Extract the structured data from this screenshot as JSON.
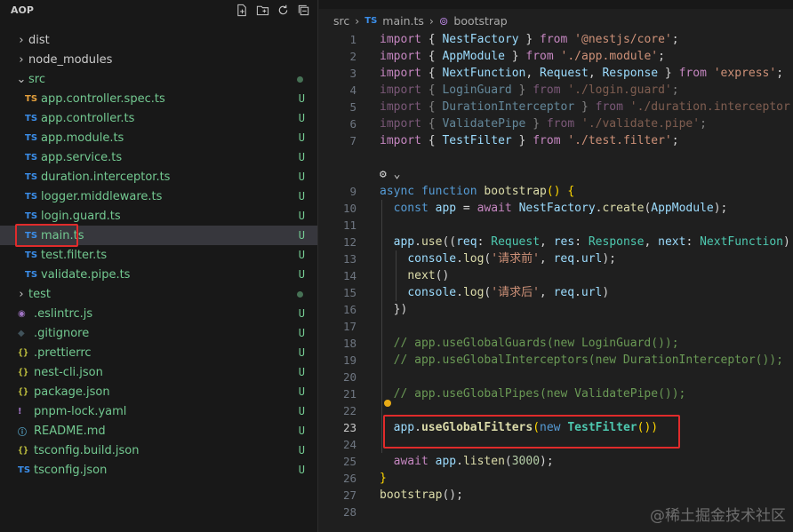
{
  "explorer": {
    "title": "AOP",
    "actions": [
      "new-file-icon",
      "new-folder-icon",
      "refresh-icon",
      "collapse-all-icon"
    ],
    "items": [
      {
        "name": "dist",
        "type": "folder",
        "open": false,
        "depth": 0,
        "status": ""
      },
      {
        "name": "node_modules",
        "type": "folder",
        "open": false,
        "depth": 0,
        "status": ""
      },
      {
        "name": "src",
        "type": "folder",
        "open": true,
        "depth": 0,
        "status": "dot"
      },
      {
        "name": "app.controller.spec.ts",
        "type": "ts-test",
        "depth": 1,
        "status": "U"
      },
      {
        "name": "app.controller.ts",
        "type": "ts",
        "depth": 1,
        "status": "U"
      },
      {
        "name": "app.module.ts",
        "type": "ts",
        "depth": 1,
        "status": "U"
      },
      {
        "name": "app.service.ts",
        "type": "ts",
        "depth": 1,
        "status": "U"
      },
      {
        "name": "duration.interceptor.ts",
        "type": "ts",
        "depth": 1,
        "status": "U"
      },
      {
        "name": "logger.middleware.ts",
        "type": "ts",
        "depth": 1,
        "status": "U"
      },
      {
        "name": "login.guard.ts",
        "type": "ts",
        "depth": 1,
        "status": "U"
      },
      {
        "name": "main.ts",
        "type": "ts",
        "depth": 1,
        "status": "U",
        "selected": true
      },
      {
        "name": "test.filter.ts",
        "type": "ts",
        "depth": 1,
        "status": "U"
      },
      {
        "name": "validate.pipe.ts",
        "type": "ts",
        "depth": 1,
        "status": "U"
      },
      {
        "name": "test",
        "type": "folder",
        "open": false,
        "depth": 0,
        "status": "dot"
      },
      {
        "name": ".eslintrc.js",
        "type": "js",
        "depth": 0,
        "status": "U"
      },
      {
        "name": ".gitignore",
        "type": "git",
        "depth": 0,
        "status": "U"
      },
      {
        "name": ".prettierrc",
        "type": "json",
        "depth": 0,
        "status": "U"
      },
      {
        "name": "nest-cli.json",
        "type": "json",
        "depth": 0,
        "status": "U"
      },
      {
        "name": "package.json",
        "type": "json",
        "depth": 0,
        "status": "U"
      },
      {
        "name": "pnpm-lock.yaml",
        "type": "yaml",
        "depth": 0,
        "status": "U"
      },
      {
        "name": "README.md",
        "type": "md",
        "depth": 0,
        "status": "U"
      },
      {
        "name": "tsconfig.build.json",
        "type": "json",
        "depth": 0,
        "status": "U"
      },
      {
        "name": "tsconfig.json",
        "type": "tsconfig",
        "depth": 0,
        "status": "U"
      }
    ]
  },
  "breadcrumb": {
    "folder": "src",
    "file_badge": "TS",
    "file": "main.ts",
    "symbol": "bootstrap"
  },
  "editor": {
    "current_line": 23,
    "lines": [
      {
        "n": "1",
        "html": "<span class=\"kw\">import</span><span class=\"pl\"> { </span><span class=\"var\">NestFactory</span><span class=\"pl\"> } </span><span class=\"kw\">from</span><span class=\"pl\"> </span><span class=\"str\">'@nestjs/core'</span><span class=\"pl\">;</span>"
      },
      {
        "n": "2",
        "html": "<span class=\"kw\">import</span><span class=\"pl\"> { </span><span class=\"var\">AppModule</span><span class=\"pl\"> } </span><span class=\"kw\">from</span><span class=\"pl\"> </span><span class=\"str\">'./app.module'</span><span class=\"pl\">;</span>"
      },
      {
        "n": "3",
        "html": "<span class=\"kw\">import</span><span class=\"pl\"> { </span><span class=\"var\">NextFunction</span><span class=\"pl\">, </span><span class=\"var\">Request</span><span class=\"pl\">, </span><span class=\"var\">Response</span><span class=\"pl\"> } </span><span class=\"kw\">from</span><span class=\"pl\"> </span><span class=\"str\">'express'</span><span class=\"pl\">;</span>"
      },
      {
        "n": "4",
        "html": "<span class=\"dim\"><span class=\"kw\">import</span><span class=\"pl\"> { </span><span class=\"var\">LoginGuard</span><span class=\"pl\"> } </span><span class=\"kw\">from</span><span class=\"pl\"> </span><span class=\"str\">'./login.guard'</span><span class=\"pl\">;</span></span>"
      },
      {
        "n": "5",
        "html": "<span class=\"dim\"><span class=\"kw\">import</span><span class=\"pl\"> { </span><span class=\"var\">DurationInterceptor</span><span class=\"pl\"> } </span><span class=\"kw\">from</span><span class=\"pl\"> </span><span class=\"str\">'./duration.interceptor'</span><span class=\"pl\">;</span></span>"
      },
      {
        "n": "6",
        "html": "<span class=\"dim\"><span class=\"kw\">import</span><span class=\"pl\"> { </span><span class=\"var\">ValidatePipe</span><span class=\"pl\"> } </span><span class=\"kw\">from</span><span class=\"pl\"> </span><span class=\"str\">'./validate.pipe'</span><span class=\"pl\">;</span></span>"
      },
      {
        "n": "7",
        "html": "<span class=\"kw\">import</span><span class=\"pl\"> { </span><span class=\"var\">TestFilter</span><span class=\"pl\"> } </span><span class=\"kw\">from</span><span class=\"pl\"> </span><span class=\"str\">'./test.filter'</span><span class=\"pl\">;</span>"
      },
      {
        "n": "",
        "html": ""
      },
      {
        "n": "",
        "html": "<span class=\"pl\">⚙︎ ⌄</span>"
      },
      {
        "n": "9",
        "html": "<span class=\"kb\">async</span><span class=\"pl\"> </span><span class=\"kb\">function</span><span class=\"pl\"> </span><span class=\"fn\">bootstrap</span><span class=\"br\">()</span><span class=\"pl\"> </span><span class=\"br\">{</span>"
      },
      {
        "n": "10",
        "html": "<span class=\"pl\">  </span><span class=\"kb\">const</span><span class=\"pl\"> </span><span class=\"var\">app</span><span class=\"pl\"> = </span><span class=\"kw\">await</span><span class=\"pl\"> </span><span class=\"var\">NestFactory</span><span class=\"pl\">.</span><span class=\"fn\">create</span><span class=\"pl\">(</span><span class=\"var\">AppModule</span><span class=\"pl\">);</span>"
      },
      {
        "n": "11",
        "html": ""
      },
      {
        "n": "12",
        "html": "<span class=\"pl\">  </span><span class=\"var\">app</span><span class=\"pl\">.</span><span class=\"fn\">use</span><span class=\"pl\">((</span><span class=\"var\">req</span><span class=\"pl\">: </span><span class=\"cls\">Request</span><span class=\"pl\">, </span><span class=\"var\">res</span><span class=\"pl\">: </span><span class=\"cls\">Response</span><span class=\"pl\">, </span><span class=\"var\">next</span><span class=\"pl\">: </span><span class=\"cls\">NextFunction</span><span class=\"pl\">) =&gt;</span>"
      },
      {
        "n": "13",
        "html": "<span class=\"pl\">    </span><span class=\"var\">console</span><span class=\"pl\">.</span><span class=\"fn\">log</span><span class=\"pl\">(</span><span class=\"str\">'请求前'</span><span class=\"pl\">, </span><span class=\"var\">req</span><span class=\"pl\">.</span><span class=\"var\">url</span><span class=\"pl\">);</span>"
      },
      {
        "n": "14",
        "html": "<span class=\"pl\">    </span><span class=\"fn\">next</span><span class=\"pl\">()</span>"
      },
      {
        "n": "15",
        "html": "<span class=\"pl\">    </span><span class=\"var\">console</span><span class=\"pl\">.</span><span class=\"fn\">log</span><span class=\"pl\">(</span><span class=\"str\">'请求后'</span><span class=\"pl\">, </span><span class=\"var\">req</span><span class=\"pl\">.</span><span class=\"var\">url</span><span class=\"pl\">)</span>"
      },
      {
        "n": "16",
        "html": "<span class=\"pl\">  })</span>"
      },
      {
        "n": "17",
        "html": ""
      },
      {
        "n": "18",
        "html": "<span class=\"cm\">  // app.useGlobalGuards(new LoginGuard());</span>"
      },
      {
        "n": "19",
        "html": "<span class=\"cm\">  // app.useGlobalInterceptors(new DurationInterceptor());</span>"
      },
      {
        "n": "20",
        "html": ""
      },
      {
        "n": "21",
        "html": "<span class=\"cm\">  // app.useGlobalPipes(new ValidatePipe());</span>"
      },
      {
        "n": "22",
        "html": ""
      },
      {
        "n": "23",
        "html": "<span class=\"pl\">  </span><span class=\"var\">app</span><span class=\"pl\">.</span><span class=\"fn bold\">useGlobalFilters</span><span class=\"br\">(</span><span class=\"kb\">new</span><span class=\"pl\"> </span><span class=\"cls bold\">TestFilter</span><span class=\"br\">()</span><span class=\"br\">)</span>"
      },
      {
        "n": "24",
        "html": ""
      },
      {
        "n": "25",
        "html": "<span class=\"pl\">  </span><span class=\"kw\">await</span><span class=\"pl\"> </span><span class=\"var\">app</span><span class=\"pl\">.</span><span class=\"fn\">listen</span><span class=\"pl\">(</span><span class=\"num\">3000</span><span class=\"pl\">);</span>"
      },
      {
        "n": "26",
        "html": "<span class=\"br\">}</span>"
      },
      {
        "n": "27",
        "html": "<span class=\"fn\">bootstrap</span><span class=\"pl\">();</span>"
      },
      {
        "n": "28",
        "html": ""
      }
    ]
  },
  "watermark": "@稀土掘金技术社区"
}
